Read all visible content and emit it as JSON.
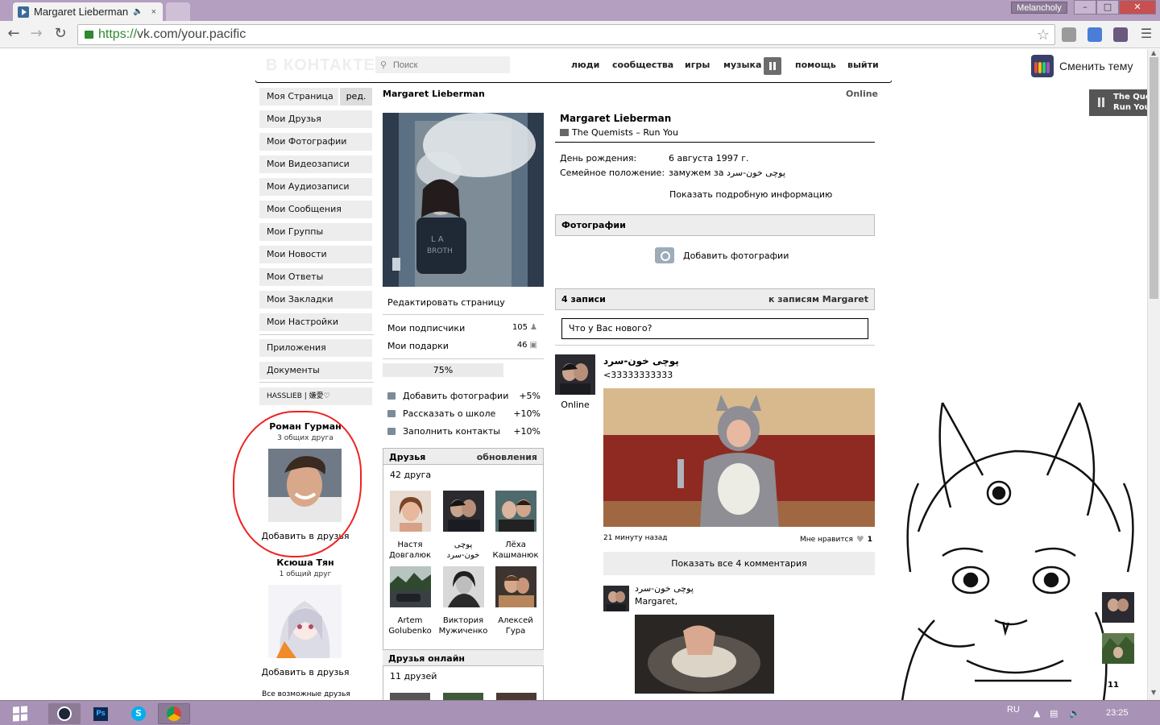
{
  "browser": {
    "tab_title": "Margaret Lieberman",
    "tab_audio_icon": "speaker-icon",
    "tab_close": "×",
    "user_badge": "Melancholy",
    "url_scheme": "https://",
    "url_rest": "vk.com/your.pacific"
  },
  "header": {
    "logo": "В КОНТАКТЕ",
    "search_placeholder": "Поиск",
    "nav": [
      "люди",
      "сообщества",
      "игры",
      "музыка",
      "помощь",
      "выйти"
    ]
  },
  "theme": {
    "label": "Сменить тему",
    "player_line1": "The Quemists",
    "player_line2": "Run You",
    "colors": [
      "#e74c3c",
      "#f1c40f",
      "#2ecc71",
      "#3498db",
      "#9b59b6"
    ]
  },
  "menu": {
    "items": [
      "Моя Страница",
      "Мои Друзья",
      "Мои Фотографии",
      "Мои Видеозаписи",
      "Мои Аудиозаписи",
      "Мои Сообщения",
      "Мои Группы",
      "Мои Новости",
      "Мои Ответы",
      "Мои Закладки",
      "Мои Настройки"
    ],
    "edit": "ред.",
    "extra": [
      "Приложения",
      "Документы"
    ],
    "app_item": "HASSLIEB | 嫌愛♡"
  },
  "suggestions": [
    {
      "name": "Роман Гурман",
      "mutual": "3 общих друга",
      "add": "Добавить в друзья"
    },
    {
      "name": "Ксюша Тян",
      "mutual": "1 общий друг",
      "add": "Добавить в друзья"
    }
  ],
  "all_friends_link": "Все возможные друзья",
  "profile": {
    "name": "Margaret Lieberman",
    "online": "Online",
    "status": "The Quemists – Run You",
    "edit_page": "Редактировать страницу",
    "followers_label": "Мои подписчики",
    "followers_count": "105",
    "gifts_label": "Мои подарки",
    "gifts_count": "46",
    "progress": "75%",
    "progress_value": 0.75,
    "todos": [
      {
        "label": "Добавить фотографии",
        "pct": "+5%"
      },
      {
        "label": "Рассказать о школе",
        "pct": "+10%"
      },
      {
        "label": "Заполнить контакты",
        "pct": "+10%"
      }
    ],
    "birthday_label": "День рождения:",
    "birthday": "6 августа 1997 г.",
    "relation_label": "Семейное положение:",
    "relation": "замужем за پوچی خون-سرد",
    "show_more": "Показать подробную информацию"
  },
  "friends": {
    "title": "Друзья",
    "updates": "обновления",
    "count": "42 друга",
    "list": [
      {
        "first": "Настя",
        "last": "Довгалюк"
      },
      {
        "first": "پوچی",
        "last": "خون-سرد"
      },
      {
        "first": "Лёха",
        "last": "Кашманюк"
      },
      {
        "first": "Artem",
        "last": "Golubenko"
      },
      {
        "first": "Виктория",
        "last": "Мужиченко"
      },
      {
        "first": "Алексей",
        "last": "Гура"
      }
    ],
    "online_title": "Друзья онлайн",
    "online_count": "11 друзей"
  },
  "photos": {
    "title": "Фотографии",
    "add": "Добавить фотографии"
  },
  "wall": {
    "count": "4 записи",
    "to_posts": "к записям Margaret",
    "placeholder": "Что у Вас нового?",
    "post": {
      "author": "پوچی خون-سرد",
      "text": "<33333333333",
      "online": "Online",
      "time": "21 минуту назад",
      "like_label": "Мне нравится",
      "likes": "1",
      "show_comments": "Показать все 4 комментария"
    },
    "comment": {
      "author": "پوچی خون-سرد",
      "text": "Margaret,"
    }
  },
  "side": {
    "count": "11"
  },
  "taskbar": {
    "lang": "RU",
    "clock": "23:25",
    "apps": [
      "steam-icon",
      "photoshop-icon",
      "skype-icon",
      "chrome-icon"
    ],
    "ps_label": "Ps"
  }
}
